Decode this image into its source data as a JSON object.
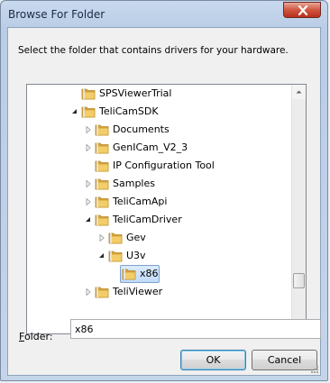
{
  "dialog": {
    "title": "Browse For Folder",
    "instruction": "Select the folder that contains drivers for your hardware."
  },
  "tree": {
    "items": [
      {
        "label": "SPSViewerTrial",
        "level": 1,
        "expander": "none"
      },
      {
        "label": "TeliCamSDK",
        "level": 1,
        "expander": "expanded"
      },
      {
        "label": "Documents",
        "level": 2,
        "expander": "collapsed"
      },
      {
        "label": "GenICam_V2_3",
        "level": 2,
        "expander": "collapsed"
      },
      {
        "label": "IP Configuration Tool",
        "level": 2,
        "expander": "none"
      },
      {
        "label": "Samples",
        "level": 2,
        "expander": "collapsed"
      },
      {
        "label": "TeliCamApi",
        "level": 2,
        "expander": "collapsed"
      },
      {
        "label": "TeliCamDriver",
        "level": 2,
        "expander": "expanded"
      },
      {
        "label": "Gev",
        "level": 3,
        "expander": "collapsed"
      },
      {
        "label": "U3v",
        "level": 3,
        "expander": "expanded"
      },
      {
        "label": "x86",
        "level": 4,
        "expander": "none",
        "selected": true
      },
      {
        "label": "TeliViewer",
        "level": 2,
        "expander": "collapsed"
      }
    ]
  },
  "folder_field": {
    "label_prefix": "F",
    "label_rest": "older:",
    "value": "x86"
  },
  "buttons": {
    "ok": "OK",
    "cancel": "Cancel"
  },
  "icons": {
    "close": "close-icon",
    "folder": "folder-icon",
    "expander_collapsed": "triangle-right-icon",
    "expander_expanded": "triangle-down-icon"
  },
  "colors": {
    "selection": "#cce4fc",
    "folder": "#e8b94a"
  }
}
